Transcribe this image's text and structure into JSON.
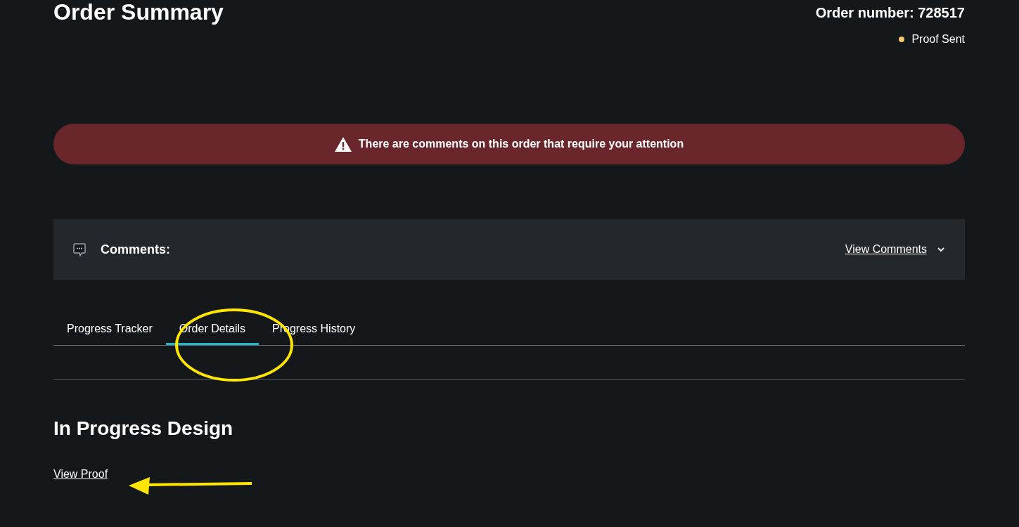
{
  "page": {
    "title": "Order Summary",
    "order_number": "Order number: 728517",
    "status": "Proof Sent"
  },
  "alert": {
    "message": "There are comments on this order that require your attention"
  },
  "comments": {
    "label": "Comments:",
    "link": "View Comments",
    "expanded": false
  },
  "tabs": [
    {
      "label": "Progress Tracker",
      "selected": false
    },
    {
      "label": "Order Details",
      "selected": true
    },
    {
      "label": "Progress History",
      "selected": false
    }
  ],
  "section": {
    "heading": "In Progress Design",
    "link": "View Proof"
  }
}
